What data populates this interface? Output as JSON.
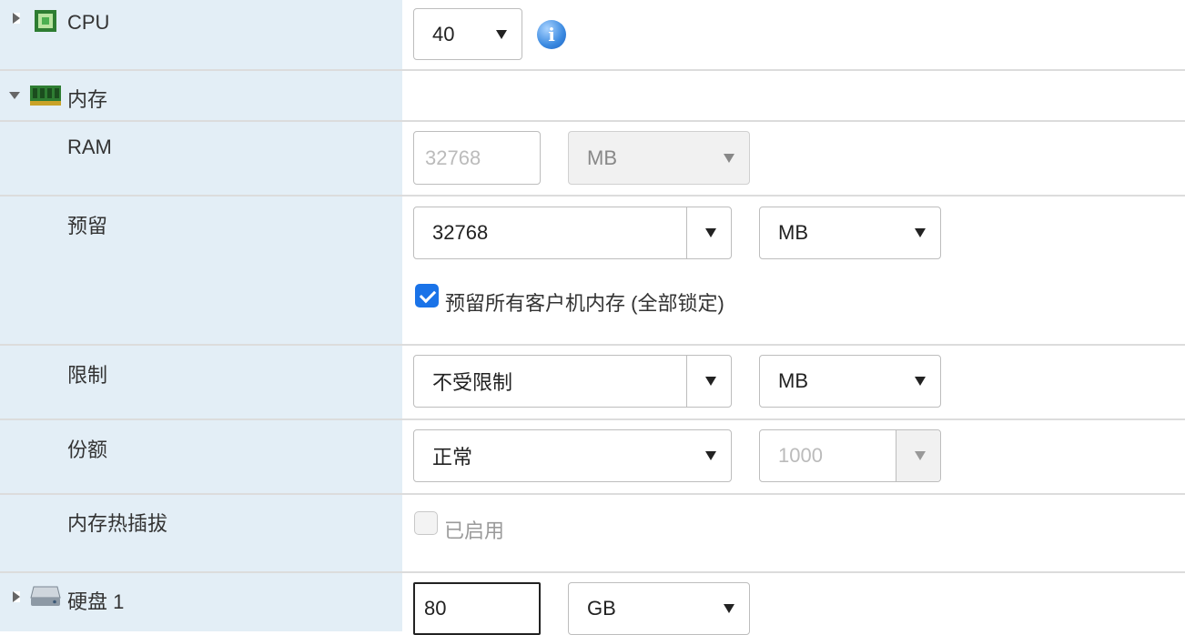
{
  "cpu": {
    "label": "CPU",
    "icon": "cpu-icon",
    "value": "40",
    "info_glyph": "i"
  },
  "memory": {
    "label": "内存",
    "icon": "memory-icon",
    "ram": {
      "label": "RAM",
      "placeholder": "32768",
      "unit": "MB"
    },
    "reservation": {
      "label": "预留",
      "value": "32768",
      "unit": "MB",
      "lock_all_label": "预留所有客户机内存 (全部锁定)",
      "lock_all_checked": true
    },
    "limit": {
      "label": "限制",
      "value": "不受限制",
      "unit": "MB"
    },
    "shares": {
      "label": "份额",
      "value": "正常",
      "custom_value": "1000"
    },
    "hotplug": {
      "label": "内存热插拔",
      "enabled_label": "已启用",
      "checked": false
    }
  },
  "disk": {
    "label": "硬盘 1",
    "icon": "hard-disk-icon",
    "size": "80",
    "unit": "GB"
  }
}
